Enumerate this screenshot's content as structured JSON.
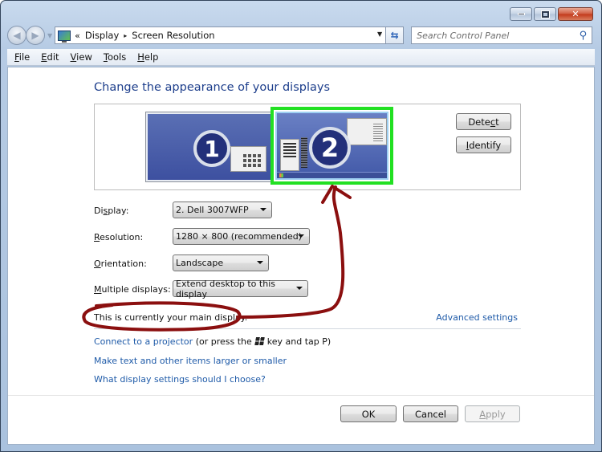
{
  "window": {
    "controls": {
      "minimize_icon": "minimize-icon",
      "maximize_icon": "maximize-icon",
      "close_glyph": "✕"
    }
  },
  "navigation": {
    "back_icon": "back-arrow-icon",
    "forward_icon": "forward-arrow-icon",
    "breadcrumb": {
      "overflow": "«",
      "items": [
        "Display",
        "Screen Resolution"
      ],
      "separator": "▸"
    },
    "refresh_glyph": "⇆",
    "search_placeholder": "Search Control Panel",
    "search_glyph": "⚲"
  },
  "menubar": {
    "items": [
      {
        "label": "File",
        "access": "F",
        "rest": "ile"
      },
      {
        "label": "Edit",
        "access": "E",
        "rest": "dit"
      },
      {
        "label": "View",
        "access": "V",
        "rest": "iew"
      },
      {
        "label": "Tools",
        "access": "T",
        "rest": "ools"
      },
      {
        "label": "Help",
        "access": "H",
        "rest": "elp"
      }
    ]
  },
  "main": {
    "title": "Change the appearance of your displays",
    "monitors": [
      {
        "number": "1",
        "selected": false
      },
      {
        "number": "2",
        "selected": true
      }
    ],
    "selection_color": "#22e022",
    "detect_button": {
      "pre": "Dete",
      "access": "c",
      "post": "t"
    },
    "identify_button": {
      "pre": "",
      "access": "I",
      "post": "dentify"
    },
    "form": {
      "display": {
        "label_pre": "Di",
        "label_access": "s",
        "label_post": "play:",
        "value": "2. Dell 3007WFP"
      },
      "resolution": {
        "label_pre": "",
        "label_access": "R",
        "label_post": "esolution:",
        "value": "1280 × 800 (recommended)"
      },
      "orientation": {
        "label_pre": "",
        "label_access": "O",
        "label_post": "rientation:",
        "value": "Landscape"
      },
      "multiple_displays": {
        "label_pre": "",
        "label_access": "M",
        "label_post": "ultiple displays:",
        "value": "Extend desktop to this display"
      }
    },
    "main_display_text": "This is currently your main display.",
    "advanced_settings": "Advanced settings",
    "links": {
      "projector": "Connect to a projector",
      "projector_suffix_1": "(or press the",
      "projector_suffix_2": "key and tap P)",
      "text_size": "Make text and other items larger or smaller",
      "help": "What display settings should I choose?"
    }
  },
  "footer": {
    "ok": "OK",
    "cancel": "Cancel",
    "apply": {
      "access": "A",
      "rest": "pply"
    }
  },
  "annotation": {
    "color": "#8b0f0f",
    "description": "hand-drawn circle around main display text with arrow pointing to monitor 2"
  }
}
